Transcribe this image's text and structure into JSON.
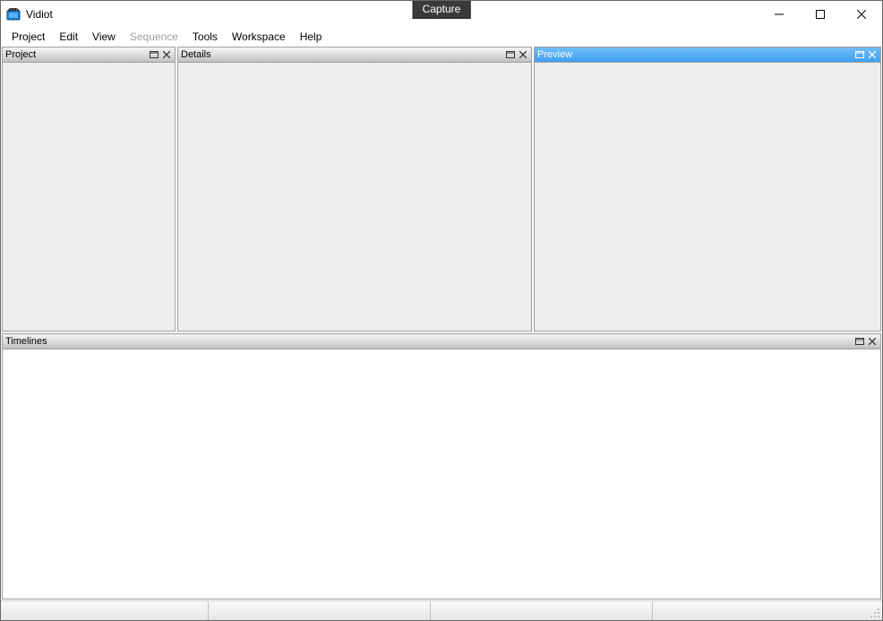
{
  "badge": {
    "label": "Capture"
  },
  "window": {
    "title": "Vidiot"
  },
  "menu": {
    "items": [
      {
        "label": "Project",
        "enabled": true
      },
      {
        "label": "Edit",
        "enabled": true
      },
      {
        "label": "View",
        "enabled": true
      },
      {
        "label": "Sequence",
        "enabled": false
      },
      {
        "label": "Tools",
        "enabled": true
      },
      {
        "label": "Workspace",
        "enabled": true
      },
      {
        "label": "Help",
        "enabled": true
      }
    ]
  },
  "panels": {
    "project": {
      "title": "Project",
      "active": false
    },
    "details": {
      "title": "Details",
      "active": false
    },
    "preview": {
      "title": "Preview",
      "active": true
    },
    "timelines": {
      "title": "Timelines",
      "active": false
    }
  }
}
